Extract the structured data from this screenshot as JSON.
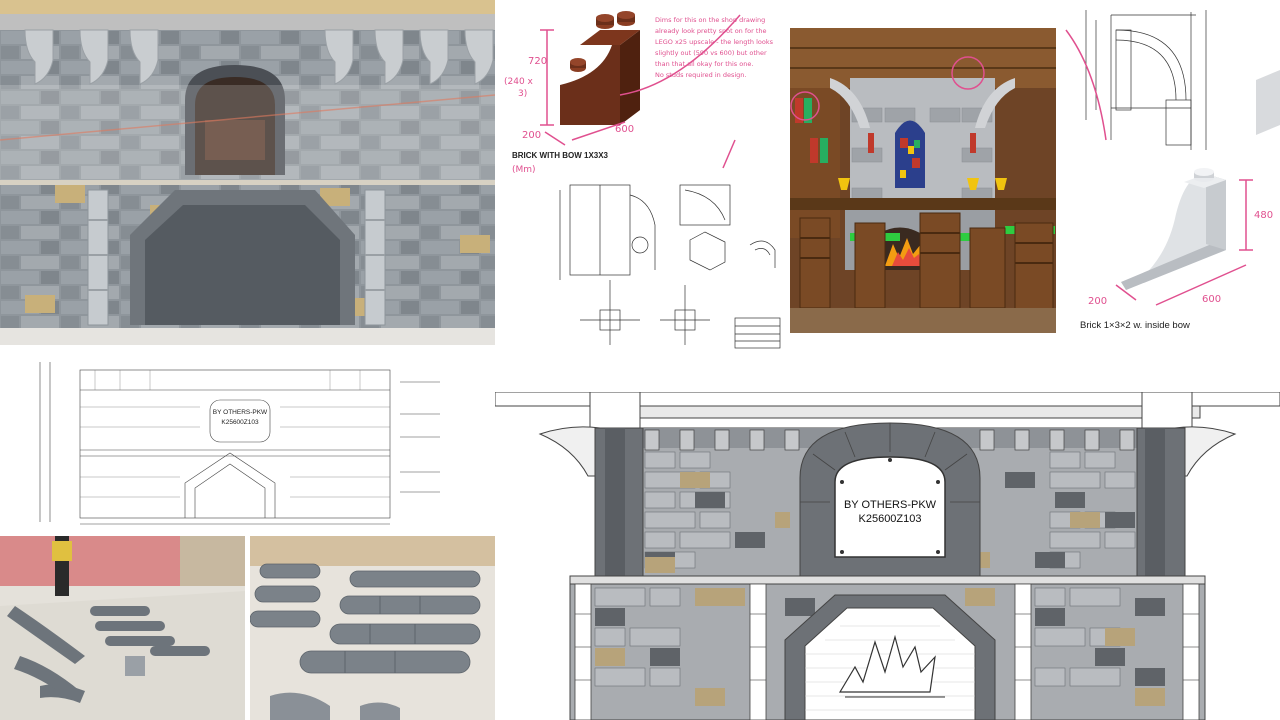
{
  "note": {
    "lines": [
      "Dims for this on the shop drawing",
      "already look pretty spot on for the",
      "LEGO x25 upscale - the length looks",
      "slightly out (590 vs 600) but other",
      "than that all okay for this one.",
      "No studs required in design."
    ],
    "color": "#e0508f"
  },
  "brick_bow": {
    "caption": "BRICK WITH BOW 1X3X3",
    "dim_height_top": "720",
    "dim_height_mid": "(240 x",
    "dim_height_bot": "3)",
    "dim_width": "200",
    "dim_length": "600",
    "handnote": "(Mm)"
  },
  "brick_inside_bow": {
    "caption": "Brick 1×3×2 w. inside bow",
    "dim_height": "480",
    "dim_width": "200",
    "dim_length": "600"
  },
  "elevation": {
    "label_line1": "BY OTHERS-PKW",
    "label_line2": "K25600Z103"
  },
  "drawing": {
    "label_line1": "BY OTHERS-PKW",
    "label_line2": "K25600Z103"
  },
  "colors": {
    "stone_light": "#a9acb0",
    "stone_mid": "#8e9297",
    "stone_dark": "#5f6368",
    "tan": "#b7a37a",
    "annotation_pink": "#e0508f",
    "brick_brown": "#6b2f1a",
    "wood": "#7a4a25"
  }
}
